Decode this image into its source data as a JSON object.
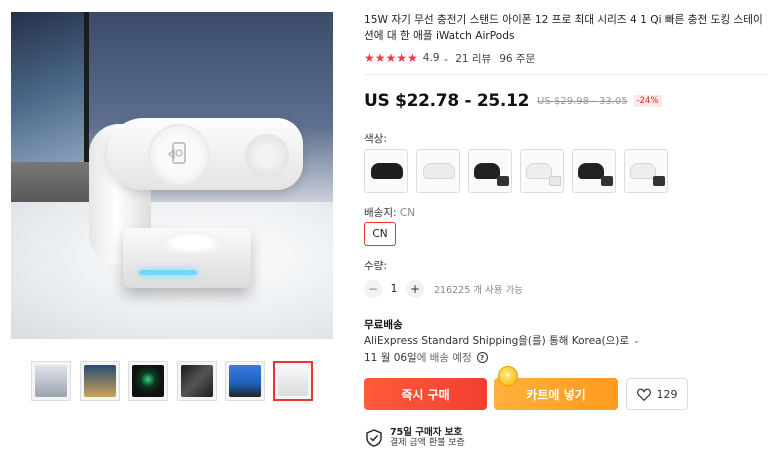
{
  "product": {
    "title": "15W 자기 무선 충전기 스탠드 아이폰 12 프로 최대 시리즈 4 1 Qi 빠른 충전 도킹 스테이션에 대 한 애플 iWatch AirPods",
    "rating": "4.9",
    "rating_chevron": "⌄",
    "reviews": "21 리뷰",
    "orders": "96 주문",
    "price": "US $22.78 - 25.12",
    "original_price": "US $29.98 - 33.05",
    "discount": "-24%"
  },
  "options": {
    "color_label": "색상:",
    "color_swatches": [
      {
        "name": "black-stand",
        "tone": "#222222"
      },
      {
        "name": "white-stand",
        "tone": "#eeeeee"
      },
      {
        "name": "black-bundle-1",
        "tone": "#2a2a2a"
      },
      {
        "name": "white-bundle-1",
        "tone": "#f0f0f0"
      },
      {
        "name": "black-bundle-2",
        "tone": "#262626"
      },
      {
        "name": "white-bundle-2",
        "tone": "#ececec"
      }
    ],
    "ship_from_label": "배송지:",
    "ship_from_value": "CN",
    "ship_from_option": "CN"
  },
  "quantity": {
    "label": "수량:",
    "minus": "−",
    "plus": "+",
    "value": "1",
    "available": "216225 개 사용 가능"
  },
  "shipping": {
    "title": "무료배송",
    "via": "AliExpress Standard Shipping을(를) 통해 Korea(으)로",
    "via_chevron": "⌄",
    "delivery_date": "11 월 06일",
    "delivery_suffix": "에 배송 예정",
    "help": "?"
  },
  "actions": {
    "buy_now": "즉시 구매",
    "add_to_cart": "카트에 넣기",
    "coin_icon": "⚡",
    "wishlist_count": "129"
  },
  "protection": {
    "title": "75일 구매자 보호",
    "subtitle": "결제 금액 환불 보증"
  },
  "gallery": {
    "thumbnails": [
      {
        "name": "thumb-1",
        "bg": "#cfd6df"
      },
      {
        "name": "thumb-2",
        "bg": "#2a4c73"
      },
      {
        "name": "thumb-3",
        "bg": "#111111"
      },
      {
        "name": "thumb-4",
        "bg": "#1b1b1b"
      },
      {
        "name": "thumb-5",
        "bg": "#1f5fb8"
      },
      {
        "name": "thumb-6",
        "bg": "#f2f2f2"
      }
    ],
    "active_index": 5
  },
  "colors": {
    "accent_red": "#f33f2e",
    "accent_orange": "#ff9a1f",
    "star": "#f4364c"
  }
}
